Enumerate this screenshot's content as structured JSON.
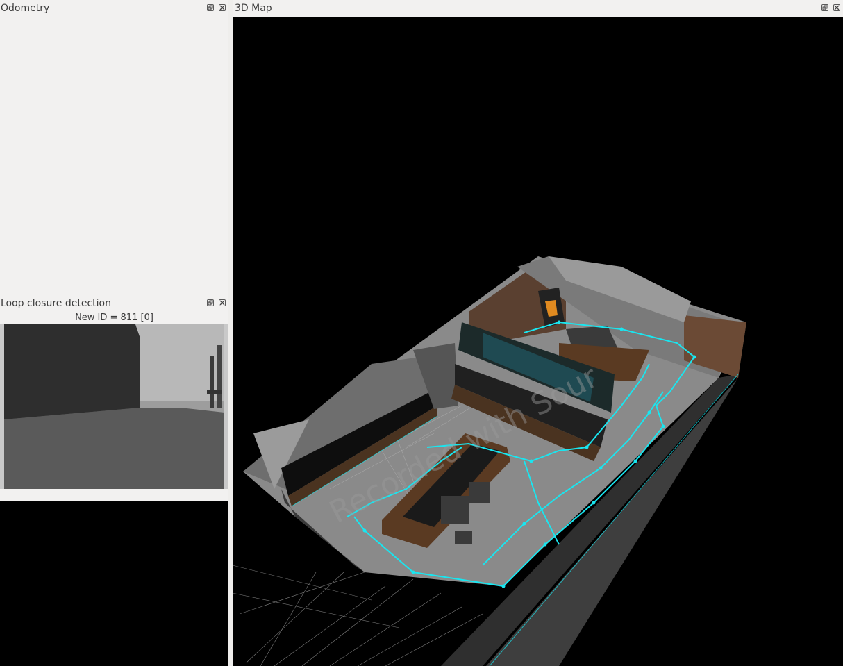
{
  "odometry": {
    "title": "Odometry"
  },
  "map3d": {
    "title": "3D Map",
    "watermark": "Recorded with Sour"
  },
  "loop_closure": {
    "title": "Loop closure detection",
    "new_id_label": "New ID = 811 [0]"
  },
  "icons": {
    "float": "dock-float-icon",
    "close": "dock-close-icon"
  },
  "colors": {
    "trajectory": "#19e6f0",
    "background": "#000000",
    "panel": "#f2f1f0"
  }
}
